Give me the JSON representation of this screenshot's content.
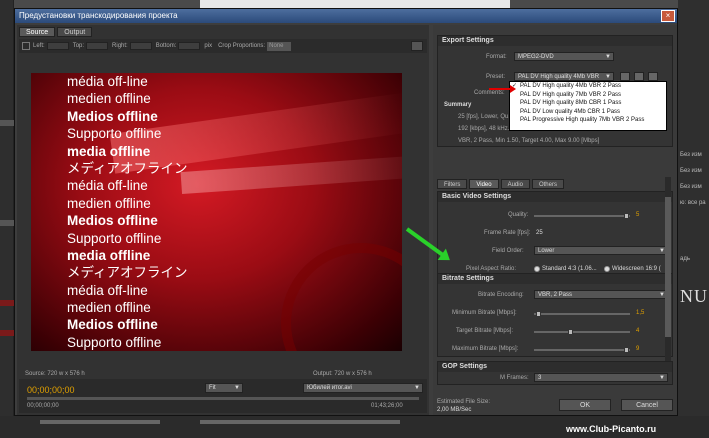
{
  "dialog": {
    "title": "Предустановки транскодирования проекта",
    "close": "×"
  },
  "left": {
    "tabs": [
      "Source",
      "Output"
    ],
    "crop": {
      "left": "Left:",
      "top": "Top:",
      "right": "Right:",
      "bottom": "Bottom:",
      "px": "pix",
      "proportions": "Crop Proportions:",
      "proportions_value": "None"
    },
    "preview_lines": [
      {
        "text": "média off-line",
        "bold": false
      },
      {
        "text": "medien offline",
        "bold": false
      },
      {
        "text": "Medios offline",
        "bold": true
      },
      {
        "text": "Supporto offline",
        "bold": false
      },
      {
        "text": "media offline",
        "bold": true
      },
      {
        "text": "メディアオフライン",
        "bold": false
      },
      {
        "text": "média off-line",
        "bold": false
      },
      {
        "text": "medien offline",
        "bold": false
      },
      {
        "text": "Medios offline",
        "bold": true
      },
      {
        "text": "Supporto offline",
        "bold": false
      },
      {
        "text": "media offline",
        "bold": true
      },
      {
        "text": "メディアオフライン",
        "bold": false
      },
      {
        "text": "média off-line",
        "bold": false
      },
      {
        "text": "medien offline",
        "bold": false
      },
      {
        "text": "Medios offline",
        "bold": true
      },
      {
        "text": "Supporto offline",
        "bold": false
      }
    ],
    "source_info": "Source: 720 w x 576 h",
    "output_info": "Output: 720 w x 576 h",
    "timecode": "00;00;00;00",
    "fit": "Fit",
    "source_name": "Юбилей итог.avi",
    "time_start": "00;00;00;00",
    "time_end": "01;43;26;00"
  },
  "right": {
    "export_settings": "Export Settings",
    "format_label": "Format:",
    "format_value": "MPEG2-DVD",
    "preset_label": "Preset:",
    "preset_value": "PAL DV High quality 4Mb VBR",
    "comments_label": "Comments:",
    "preset_options": [
      "PAL DV High quality 4Mb VBR 2 Pass",
      "PAL DV High quality 7Mb VBR 2 Pass",
      "PAL DV High quality 8Mb CBR 1 Pass",
      "PAL DV Low quality 4Mb CBR 1 Pass",
      "PAL Progressive High quality 7Mb VBR 2 Pass"
    ],
    "summary": "Summary",
    "summary_lines": [
      "25 [fps], Lower, Qu...",
      "192 [kbps], 48 kHz...",
      "VBR, 2 Pass, Min 1.50, Target 4.00, Max 9.00 [Mbps]"
    ],
    "tabs": [
      "Filters",
      "Video",
      "Audio",
      "Others"
    ],
    "basic_video": "Basic Video Settings",
    "quality_label": "Quality:",
    "quality_value": "5",
    "framerate_label": "Frame Rate [fps]:",
    "framerate_value": "25",
    "field_label": "Field Order:",
    "field_value": "Lower",
    "par_label": "Pixel Aspect Ratio:",
    "par_standard": "Standard 4:3 (1.06...",
    "par_wide": "Widescreen 16:9 (",
    "bitrate_settings": "Bitrate Settings",
    "encoding_label": "Bitrate Encoding:",
    "encoding_value": "VBR, 2 Pass",
    "min_label": "Minimum Bitrate [Mbps]:",
    "min_value": "1,5",
    "target_label": "Target Bitrate [Mbps]:",
    "target_value": "4",
    "max_label": "Maximum Bitrate [Mbps]:",
    "max_value": "9",
    "gop_settings": "GOP Settings",
    "mframes_label": "M Frames:",
    "mframes_value": "3",
    "est_label": "Estimated File Size:",
    "est_value": "2,00 MB/Sec",
    "ok": "OK",
    "cancel": "Cancel"
  },
  "background": {
    "right_labels": [
      "Без изм",
      "Без изм",
      "Без изм",
      "ю: все ра",
      "адь",
      "NU"
    ],
    "watermark": "www.Club-Picanto.ru"
  }
}
